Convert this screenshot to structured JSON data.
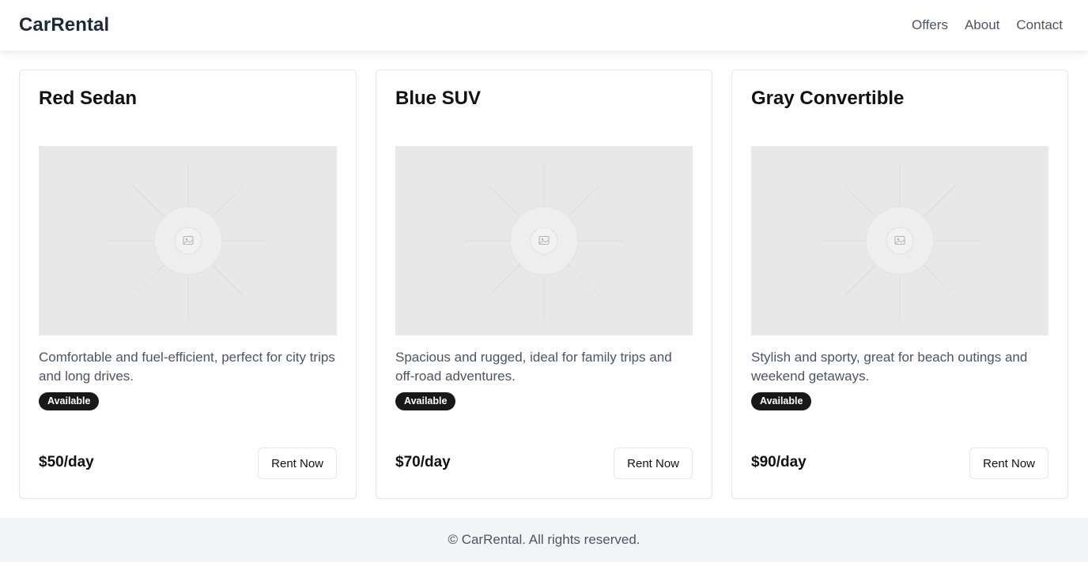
{
  "header": {
    "brand": "CarRental",
    "nav": [
      {
        "label": "Offers"
      },
      {
        "label": "About"
      },
      {
        "label": "Contact"
      }
    ]
  },
  "cars": [
    {
      "title": "Red Sedan",
      "image_icon": "image-placeholder-icon",
      "description": "Comfortable and fuel-efficient, perfect for city trips and long drives.",
      "status": "Available",
      "price": "$50/day",
      "action": "Rent Now"
    },
    {
      "title": "Blue SUV",
      "image_icon": "image-placeholder-icon",
      "description": "Spacious and rugged, ideal for family trips and off-road adventures.",
      "status": "Available",
      "price": "$70/day",
      "action": "Rent Now"
    },
    {
      "title": "Gray Convertible",
      "image_icon": "image-placeholder-icon",
      "description": "Stylish and sporty, great for beach outings and weekend getaways.",
      "status": "Available",
      "price": "$90/day",
      "action": "Rent Now"
    }
  ],
  "footer": {
    "text": "© CarRental. All rights reserved."
  },
  "colors": {
    "badge_bg": "#18181b",
    "image_bg": "#e8e8e8",
    "footer_bg": "#f3f4f6",
    "muted_text": "#4b5563"
  }
}
